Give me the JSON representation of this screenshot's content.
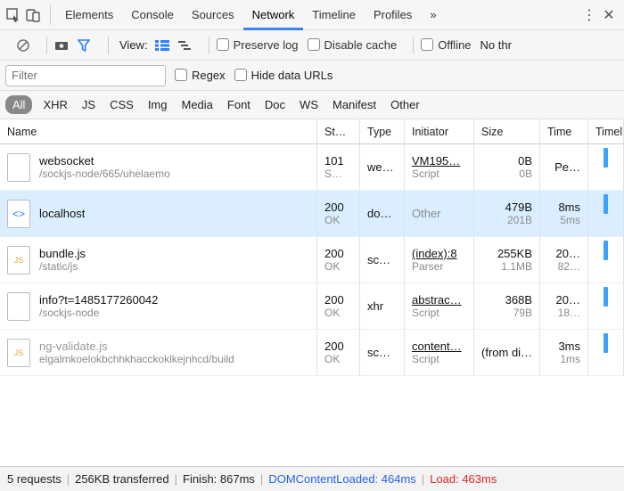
{
  "tabs": [
    "Elements",
    "Console",
    "Sources",
    "Network",
    "Timeline",
    "Profiles"
  ],
  "activeTab": "Network",
  "toolbar": {
    "view_label": "View:",
    "preserve_log": "Preserve log",
    "disable_cache": "Disable cache",
    "offline": "Offline",
    "no_throttle": "No thr"
  },
  "filter": {
    "placeholder": "Filter",
    "regex": "Regex",
    "hide_data_urls": "Hide data URLs"
  },
  "types": [
    "All",
    "XHR",
    "JS",
    "CSS",
    "Img",
    "Media",
    "Font",
    "Doc",
    "WS",
    "Manifest",
    "Other"
  ],
  "activeType": "All",
  "columns": {
    "name": "Name",
    "status": "St…",
    "type": "Type",
    "initiator": "Initiator",
    "size": "Size",
    "time": "Time",
    "waterfall": "Timel"
  },
  "rows": [
    {
      "icon": "doc",
      "name": "websocket",
      "path": "/sockjs-node/665/uhelaemo",
      "status": "101",
      "statusText": "S…",
      "type": "we…",
      "initiator": "VM195…",
      "initiatorSub": "Script",
      "size": "0B",
      "sizeSub": "0B",
      "time": "Pe…",
      "timeSub": ""
    },
    {
      "icon": "html",
      "name": "localhost",
      "path": "",
      "status": "200",
      "statusText": "OK",
      "type": "do…",
      "initiator": "Other",
      "initiatorSub": "",
      "initiatorPlain": true,
      "size": "479B",
      "sizeSub": "201B",
      "time": "8ms",
      "timeSub": "5ms",
      "selected": true
    },
    {
      "icon": "js",
      "name": "bundle.js",
      "path": "/static/js",
      "status": "200",
      "statusText": "OK",
      "type": "sc…",
      "initiator": "(index):8",
      "initiatorSub": "Parser",
      "size": "255KB",
      "sizeSub": "1.1MB",
      "time": "20…",
      "timeSub": "82…"
    },
    {
      "icon": "doc",
      "name": "info?t=1485177260042",
      "path": "/sockjs-node",
      "status": "200",
      "statusText": "OK",
      "type": "xhr",
      "initiator": "abstrac…",
      "initiatorSub": "Script",
      "size": "368B",
      "sizeSub": "79B",
      "time": "20…",
      "timeSub": "18…"
    },
    {
      "icon": "js",
      "name": "ng-validate.js",
      "path": "elgalmkoelokbchhkhacckoklkejnhcd/build",
      "status": "200",
      "statusText": "OK",
      "type": "sc…",
      "initiator": "content…",
      "initiatorSub": "Script",
      "size": "(from di…",
      "sizeSub": "",
      "time": "3ms",
      "timeSub": "1ms",
      "dim": true
    }
  ],
  "status": {
    "requests": "5 requests",
    "transferred": "256KB transferred",
    "finish": "Finish: 867ms",
    "dcl": "DOMContentLoaded: 464ms",
    "load": "Load: 463ms"
  }
}
